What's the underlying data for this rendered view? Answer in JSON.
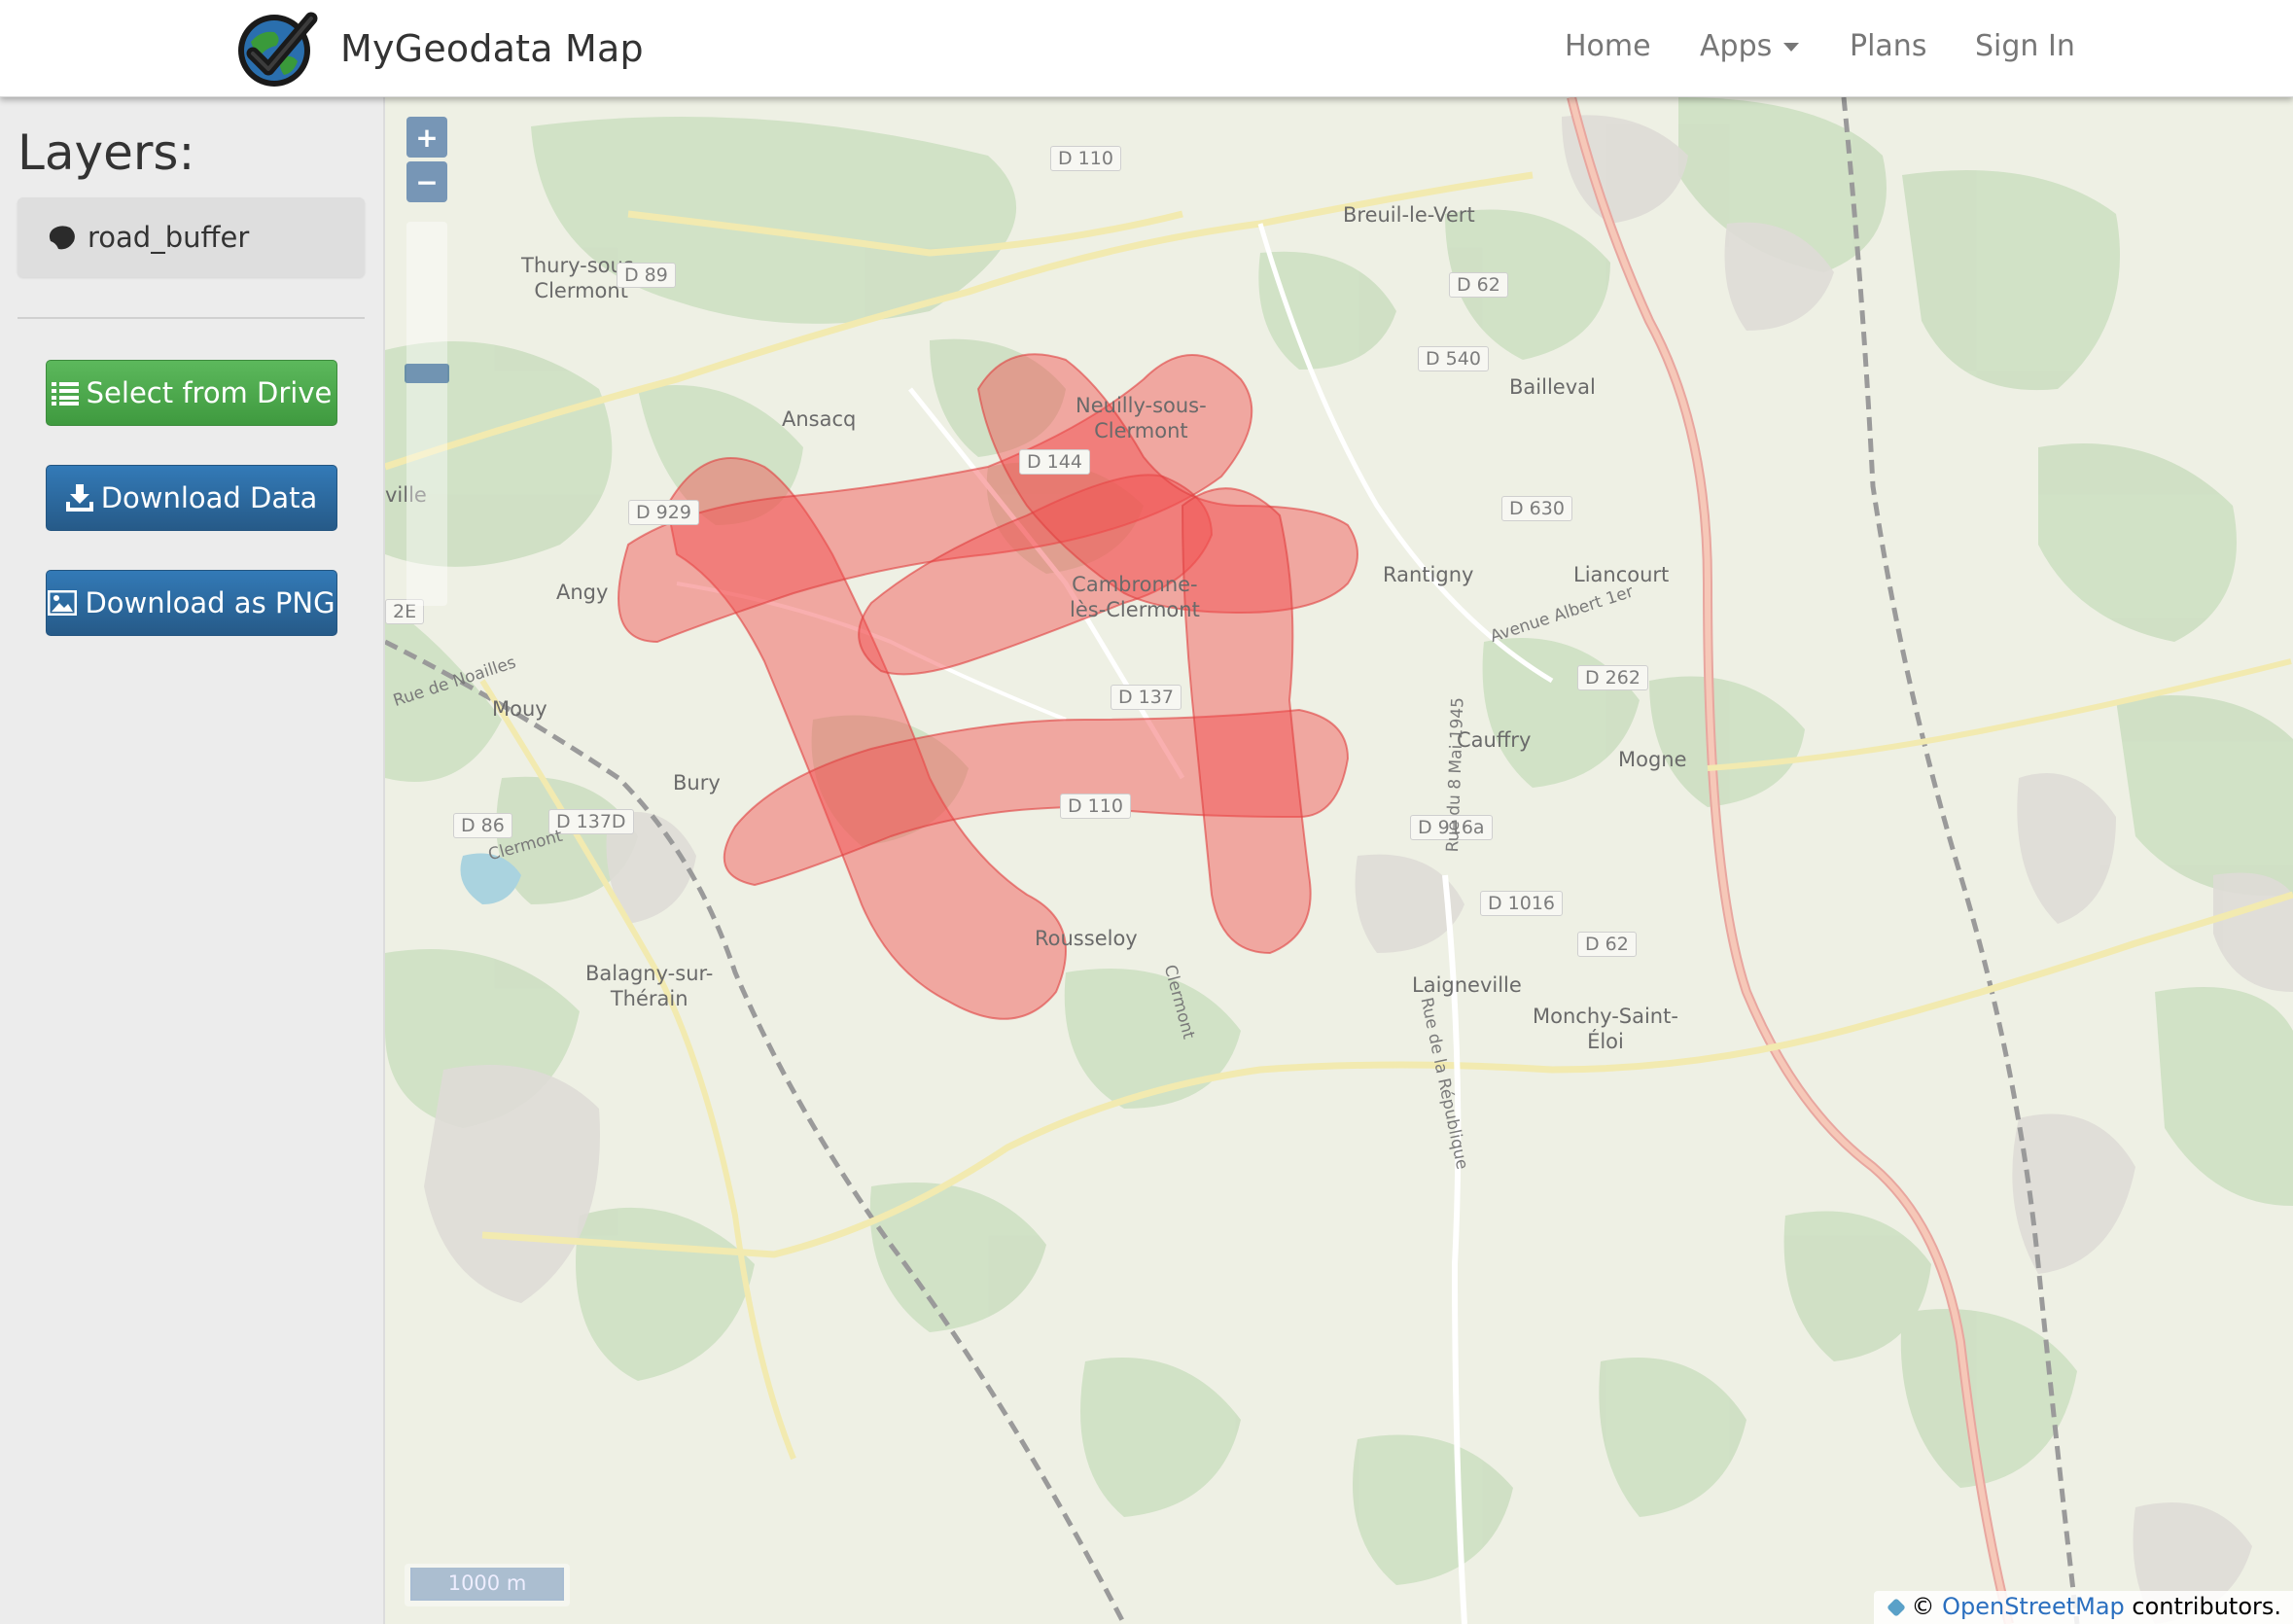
{
  "navbar": {
    "brand": "MyGeodata Map",
    "links": {
      "home": "Home",
      "apps": "Apps",
      "plans": "Plans",
      "sign_in": "Sign In"
    }
  },
  "sidebar": {
    "title": "Layers:",
    "layers": [
      {
        "name": "road_buffer",
        "icon": "polygon-icon"
      }
    ],
    "buttons": {
      "select_from_drive": "Select from Drive",
      "download_data": "Download Data",
      "download_png": "Download as PNG"
    }
  },
  "map": {
    "zoom_in": "+",
    "zoom_out": "−",
    "scale": "1000 m",
    "attribution": {
      "prefix": "©",
      "link": "OpenStreetMap",
      "suffix": "contributors."
    },
    "places": {
      "thury": "Thury-sous-\nClermont",
      "ansacq": "Ansacq",
      "neuilly": "Neuilly-sous-\nClermont",
      "breuil": "Breuil-le-Vert",
      "bailleval": "Bailleval",
      "ville": "ville",
      "angy": "Angy",
      "cambronne": "Cambronne-\nlès-Clermont",
      "rantigny": "Rantigny",
      "liancourt": "Liancourt",
      "mouy": "Mouy",
      "bury": "Bury",
      "cauffry": "Cauffry",
      "mogne": "Mogne",
      "rousseloy": "Rousseloy",
      "balagny": "Balagny-sur-\nThérain",
      "laigneville": "Laigneville",
      "monchy": "Monchy-Saint-\nÉloi"
    },
    "roads": {
      "d110_top": "D 110",
      "d89": "D 89",
      "d62_top": "D 62",
      "d540": "D 540",
      "d929": "D 929",
      "d144": "D 144",
      "d630": "D 630",
      "e2": "2E",
      "d137": "D 137",
      "d262": "D 262",
      "d86": "D 86",
      "d137d": "D 137D",
      "d110_bottom": "D 110",
      "d916a": "D 916a",
      "d1016": "D 1016",
      "d62_bottom": "D 62"
    },
    "street_labels": {
      "rue_noailles": "Rue de Noailles",
      "avenue_albert": "Avenue Albert 1er",
      "clermont": "Clermont",
      "clermont2": "Clermont",
      "rue_mai": "Rue du 8 Mai 1945",
      "rue_republique": "Rue de la République"
    },
    "layer_color": "#f24d4d"
  }
}
